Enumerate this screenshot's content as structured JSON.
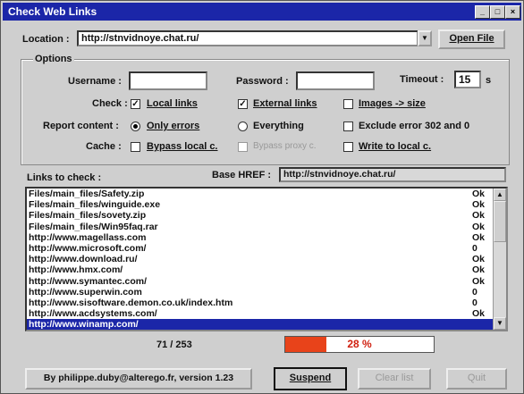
{
  "window": {
    "title": "Check Web Links",
    "min": "_",
    "max": "□",
    "close": "×"
  },
  "location": {
    "label": "Location :",
    "value": "http://stnvidnoye.chat.ru/",
    "open_label": "Open File"
  },
  "options": {
    "legend": "Options",
    "username_label": "Username :",
    "username_value": "",
    "password_label": "Password :",
    "password_value": "",
    "timeout_label": "Timeout :",
    "timeout_value": "15",
    "timeout_unit": "s",
    "check_label": "Check :",
    "local_links": {
      "label": "Local links",
      "checked": true
    },
    "external_links": {
      "label": "External links",
      "checked": true
    },
    "images_size": {
      "label": "Images -> size",
      "checked": false
    },
    "report_label": "Report content :",
    "only_errors": {
      "label": "Only errors",
      "selected": true
    },
    "everything": {
      "label": "Everything",
      "selected": false
    },
    "exclude_error": {
      "label": "Exclude error 302 and 0",
      "checked": false
    },
    "cache_label": "Cache :",
    "bypass_local": {
      "label": "Bypass local c.",
      "checked": false
    },
    "bypass_proxy": {
      "label": "Bypass proxy c.",
      "checked": false
    },
    "write_local": {
      "label": "Write to local c.",
      "checked": false
    }
  },
  "links": {
    "label": "Links to check :",
    "base_href_label": "Base HREF :",
    "base_href_value": "http://stnvidnoye.chat.ru/",
    "rows": [
      {
        "url": "Files/main_files/Safety.zip",
        "status": "Ok"
      },
      {
        "url": "Files/main_files/winguide.exe",
        "status": "Ok"
      },
      {
        "url": "Files/main_files/sovety.zip",
        "status": "Ok"
      },
      {
        "url": "Files/main_files/Win95faq.rar",
        "status": "Ok"
      },
      {
        "url": "http://www.magellass.com",
        "status": "Ok"
      },
      {
        "url": "http://www.microsoft.com/",
        "status": "0"
      },
      {
        "url": "http://www.download.ru/",
        "status": "Ok"
      },
      {
        "url": "http://www.hmx.com/",
        "status": "Ok"
      },
      {
        "url": "http://www.symantec.com/",
        "status": "Ok"
      },
      {
        "url": "http://www.superwin.com",
        "status": "0"
      },
      {
        "url": "http://www.sisoftware.demon.co.uk/index.htm",
        "status": "0"
      },
      {
        "url": "http://www.acdsystems.com/",
        "status": "Ok"
      },
      {
        "url": "http://www.winamp.com/",
        "status": ""
      }
    ],
    "selected_index": 12
  },
  "progress": {
    "count": "71 / 253",
    "fraction": 0.28,
    "percent_label": "28 %",
    "fill_color": "#e8431a"
  },
  "footer": {
    "credit": "By philippe.duby@alterego.fr, version 1.23",
    "suspend": "Suspend",
    "clear_list": "Clear list",
    "quit": "Quit"
  }
}
